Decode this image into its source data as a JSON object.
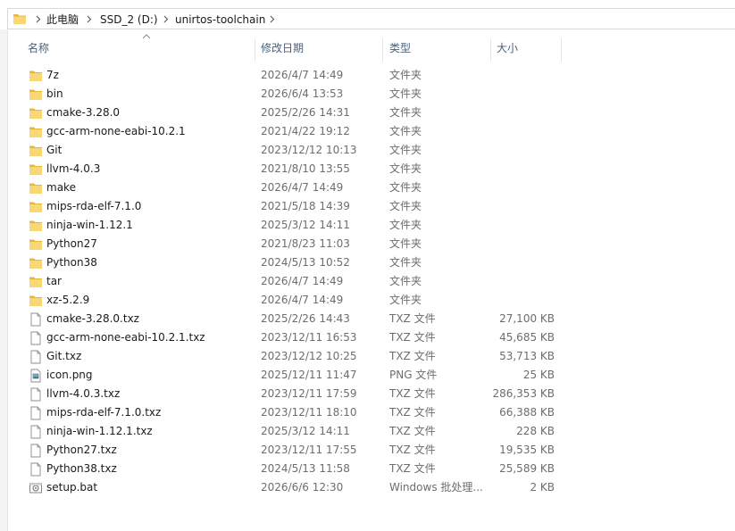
{
  "breadcrumb": {
    "items": [
      "此电脑",
      "SSD_2 (D:)",
      "unirtos-toolchain"
    ]
  },
  "columns": {
    "name": "名称",
    "modified": "修改日期",
    "type": "类型",
    "size": "大小"
  },
  "colors": {
    "folder": "#f8d775",
    "folder_dark": "#e8b73a",
    "header_text": "#4c607a",
    "secondary_text": "#6d6d6d"
  },
  "files": [
    {
      "name": "7z",
      "modified": "2026/4/7 14:49",
      "type": "文件夹",
      "size": "",
      "icon": "folder-icon"
    },
    {
      "name": "bin",
      "modified": "2026/6/4 13:53",
      "type": "文件夹",
      "size": "",
      "icon": "folder-icon"
    },
    {
      "name": "cmake-3.28.0",
      "modified": "2025/2/26 14:31",
      "type": "文件夹",
      "size": "",
      "icon": "folder-icon"
    },
    {
      "name": "gcc-arm-none-eabi-10.2.1",
      "modified": "2021/4/22 19:12",
      "type": "文件夹",
      "size": "",
      "icon": "folder-icon"
    },
    {
      "name": "Git",
      "modified": "2023/12/12 10:13",
      "type": "文件夹",
      "size": "",
      "icon": "folder-icon"
    },
    {
      "name": "llvm-4.0.3",
      "modified": "2021/8/10 13:55",
      "type": "文件夹",
      "size": "",
      "icon": "folder-icon"
    },
    {
      "name": "make",
      "modified": "2026/4/7 14:49",
      "type": "文件夹",
      "size": "",
      "icon": "folder-icon"
    },
    {
      "name": "mips-rda-elf-7.1.0",
      "modified": "2021/5/18 14:39",
      "type": "文件夹",
      "size": "",
      "icon": "folder-icon"
    },
    {
      "name": "ninja-win-1.12.1",
      "modified": "2025/3/12 14:11",
      "type": "文件夹",
      "size": "",
      "icon": "folder-icon"
    },
    {
      "name": "Python27",
      "modified": "2021/8/23 11:03",
      "type": "文件夹",
      "size": "",
      "icon": "folder-icon"
    },
    {
      "name": "Python38",
      "modified": "2024/5/13 10:52",
      "type": "文件夹",
      "size": "",
      "icon": "folder-icon"
    },
    {
      "name": "tar",
      "modified": "2026/4/7 14:49",
      "type": "文件夹",
      "size": "",
      "icon": "folder-icon"
    },
    {
      "name": "xz-5.2.9",
      "modified": "2026/4/7 14:49",
      "type": "文件夹",
      "size": "",
      "icon": "folder-icon"
    },
    {
      "name": "cmake-3.28.0.txz",
      "modified": "2025/2/26 14:43",
      "type": "TXZ 文件",
      "size": "27,100 KB",
      "icon": "file-icon"
    },
    {
      "name": "gcc-arm-none-eabi-10.2.1.txz",
      "modified": "2023/12/11 16:53",
      "type": "TXZ 文件",
      "size": "45,685 KB",
      "icon": "file-icon"
    },
    {
      "name": "Git.txz",
      "modified": "2023/12/12 10:25",
      "type": "TXZ 文件",
      "size": "53,713 KB",
      "icon": "file-icon"
    },
    {
      "name": "icon.png",
      "modified": "2025/12/11 11:47",
      "type": "PNG 文件",
      "size": "25 KB",
      "icon": "image-file-icon"
    },
    {
      "name": "llvm-4.0.3.txz",
      "modified": "2023/12/11 17:59",
      "type": "TXZ 文件",
      "size": "286,353 KB",
      "icon": "file-icon"
    },
    {
      "name": "mips-rda-elf-7.1.0.txz",
      "modified": "2023/12/11 18:10",
      "type": "TXZ 文件",
      "size": "66,388 KB",
      "icon": "file-icon"
    },
    {
      "name": "ninja-win-1.12.1.txz",
      "modified": "2025/3/12 14:11",
      "type": "TXZ 文件",
      "size": "228 KB",
      "icon": "file-icon"
    },
    {
      "name": "Python27.txz",
      "modified": "2023/12/11 17:55",
      "type": "TXZ 文件",
      "size": "19,535 KB",
      "icon": "file-icon"
    },
    {
      "name": "Python38.txz",
      "modified": "2024/5/13 11:58",
      "type": "TXZ 文件",
      "size": "25,589 KB",
      "icon": "file-icon"
    },
    {
      "name": "setup.bat",
      "modified": "2026/6/6 12:30",
      "type": "Windows 批处理...",
      "size": "2 KB",
      "icon": "batch-file-icon"
    }
  ]
}
